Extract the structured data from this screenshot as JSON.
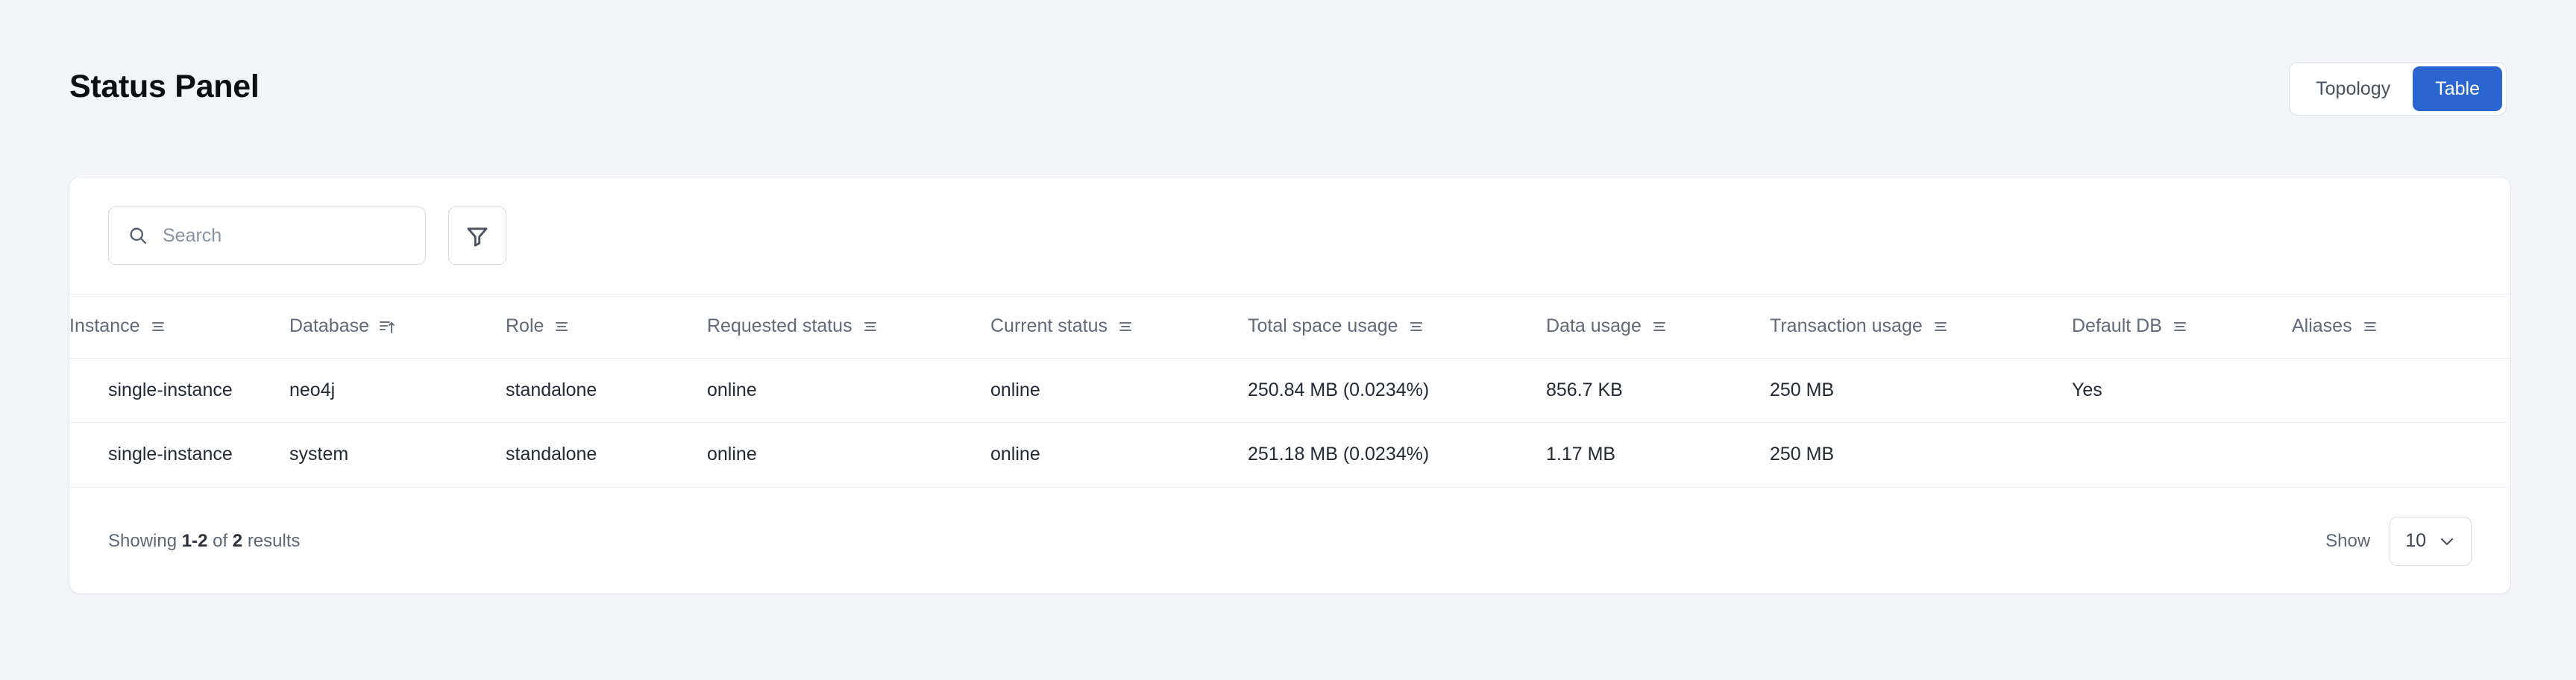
{
  "header": {
    "title": "Status Panel",
    "view_toggle": {
      "options": [
        "Topology",
        "Table"
      ],
      "topology_label": "Topology",
      "table_label": "Table",
      "active": "Table",
      "active_color": "#2b66d0"
    }
  },
  "toolbar": {
    "search_placeholder": "Search",
    "search_value": "",
    "search_icon": "search-icon",
    "filter_icon": "filter-funnel-icon"
  },
  "table": {
    "columns": [
      {
        "label": "Instance",
        "sort": "none"
      },
      {
        "label": "Database",
        "sort": "asc"
      },
      {
        "label": "Role",
        "sort": "none"
      },
      {
        "label": "Requested status",
        "sort": "none"
      },
      {
        "label": "Current status",
        "sort": "none"
      },
      {
        "label": "Total space usage",
        "sort": "none"
      },
      {
        "label": "Data usage",
        "sort": "none"
      },
      {
        "label": "Transaction usage",
        "sort": "none"
      },
      {
        "label": "Default DB",
        "sort": "none"
      },
      {
        "label": "Aliases",
        "sort": "none"
      }
    ],
    "rows": [
      {
        "instance": "single-instance",
        "database": "neo4j",
        "role": "standalone",
        "requested_status": "online",
        "current_status": "online",
        "total_space_usage": "250.84 MB (0.0234%)",
        "data_usage": "856.7 KB",
        "transaction_usage": "250 MB",
        "default_db": "Yes",
        "aliases": ""
      },
      {
        "instance": "single-instance",
        "database": "system",
        "role": "standalone",
        "requested_status": "online",
        "current_status": "online",
        "total_space_usage": "251.18 MB (0.0234%)",
        "data_usage": "1.17 MB",
        "transaction_usage": "250 MB",
        "default_db": "",
        "aliases": ""
      }
    ]
  },
  "footer": {
    "showing_prefix": "Showing",
    "showing_range": "1-2",
    "showing_of": "of",
    "showing_total": "2",
    "showing_suffix": "results",
    "show_label": "Show",
    "page_size": "10",
    "chevron_icon": "chevron-down-icon"
  }
}
